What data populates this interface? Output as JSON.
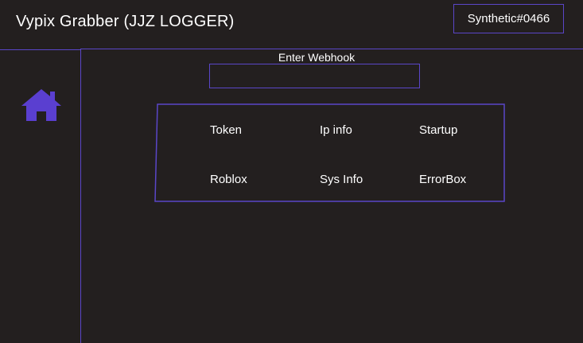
{
  "header": {
    "title": "Vypix Grabber (JJZ LOGGER)",
    "user_tag": "Synthetic#0466"
  },
  "sidebar": {
    "items": [
      {
        "icon": "home-icon"
      }
    ]
  },
  "webhook": {
    "label": "Enter Webhook",
    "value": "",
    "placeholder": ""
  },
  "options": [
    {
      "label": "Token"
    },
    {
      "label": "Ip info"
    },
    {
      "label": "Startup"
    },
    {
      "label": "Roblox"
    },
    {
      "label": "Sys Info"
    },
    {
      "label": "ErrorBox"
    }
  ],
  "colors": {
    "background": "#231f1f",
    "accent": "#5a46c8",
    "text": "#ffffff"
  }
}
